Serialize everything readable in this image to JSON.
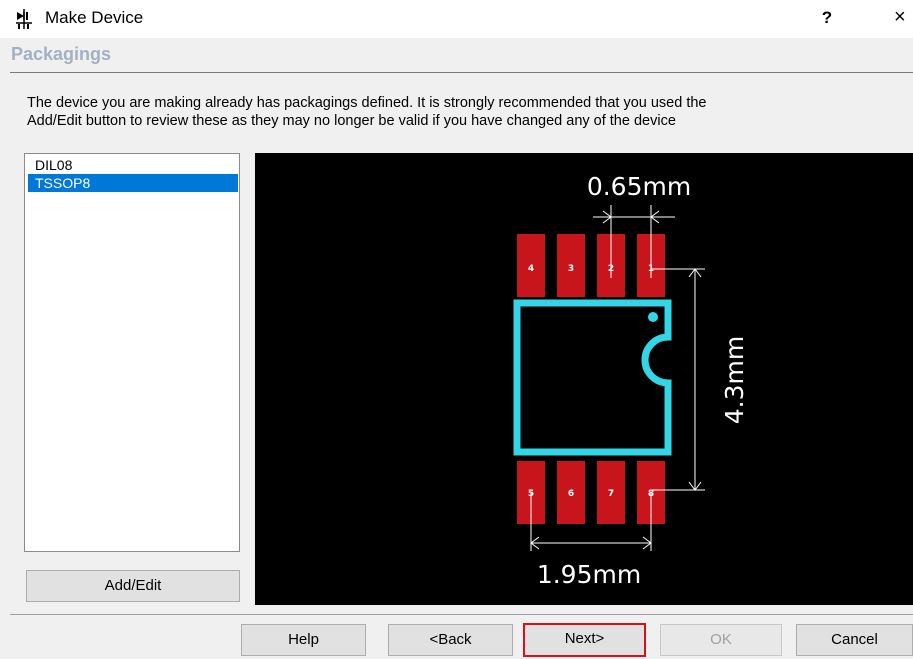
{
  "window": {
    "title": "Make Device",
    "help_label": "?",
    "close_label": "×"
  },
  "page": {
    "section_title": "Packagings",
    "description_line1": "The device you are making already has packagings defined. It is strongly recommended that you used the",
    "description_line2": "Add/Edit button to review these as they may no longer be valid if you have changed any of the device"
  },
  "packagings": {
    "items": [
      {
        "label": "DIL08",
        "selected": false
      },
      {
        "label": "TSSOP8",
        "selected": true
      }
    ],
    "add_edit_label": "Add/Edit"
  },
  "preview": {
    "pin_pitch_label": "0.65mm",
    "body_height_label": "4.3mm",
    "body_width_label": "1.95mm",
    "top_pins": [
      "4",
      "3",
      "2",
      "1"
    ],
    "bottom_pins": [
      "5",
      "6",
      "7",
      "8"
    ],
    "colors": {
      "background": "#000000",
      "pad": "#c8141b",
      "outline": "#33d6e6",
      "dimension": "#ffffff"
    }
  },
  "footer": {
    "help_label": "Help",
    "back_label": "<Back",
    "next_label": "Next>",
    "ok_label": "OK",
    "cancel_label": "Cancel"
  }
}
